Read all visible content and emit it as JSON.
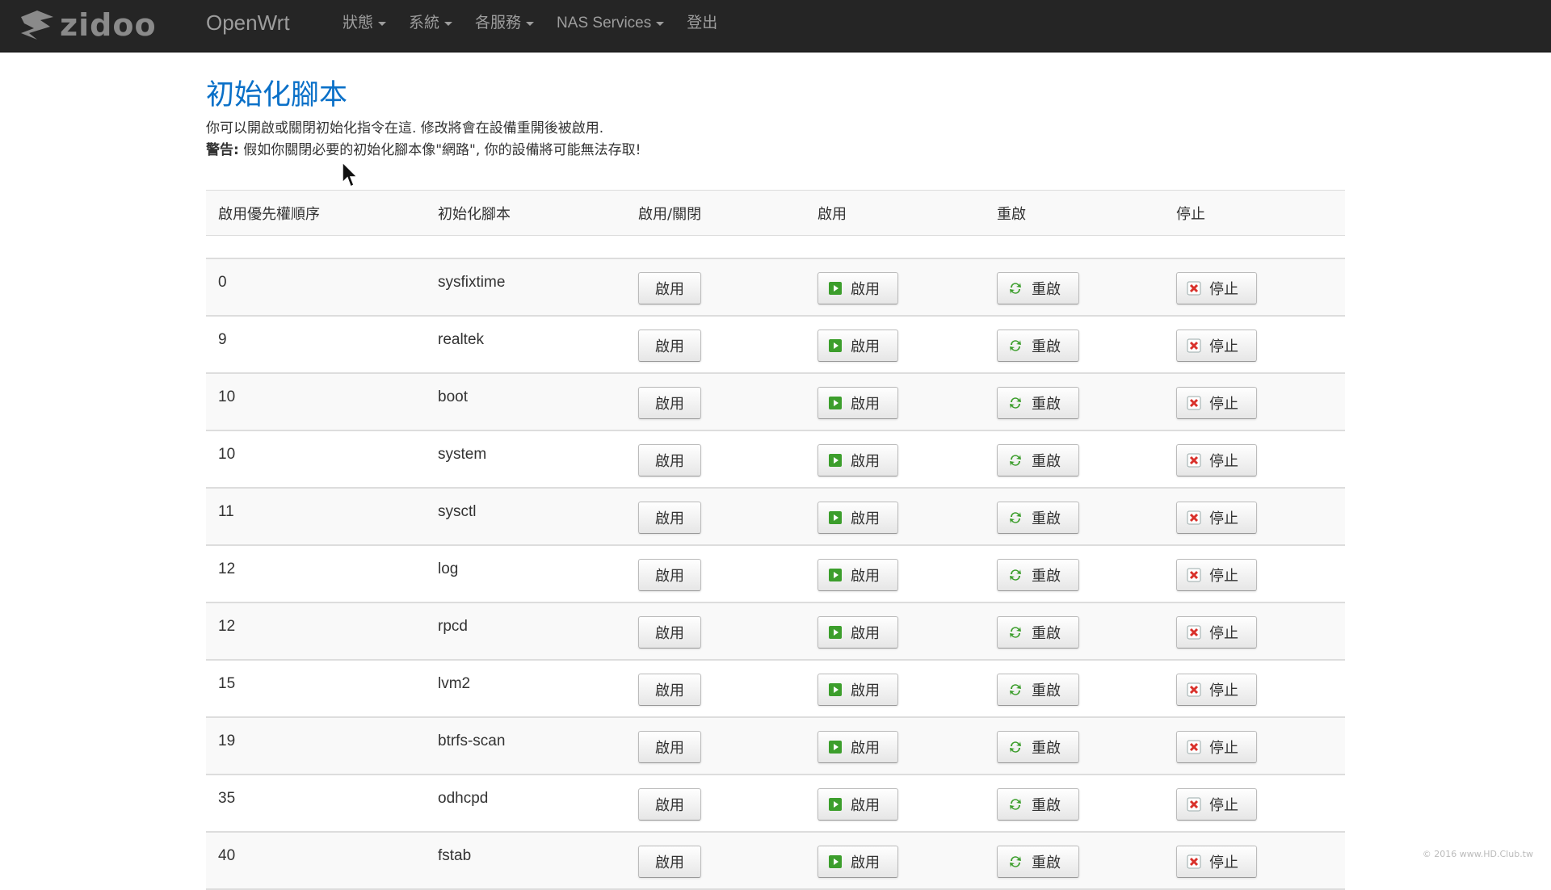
{
  "navbar": {
    "logo_text": "zidoo",
    "product": "OpenWrt",
    "menu": [
      {
        "label": "狀態",
        "dropdown": true
      },
      {
        "label": "系統",
        "dropdown": true
      },
      {
        "label": "各服務",
        "dropdown": true
      },
      {
        "label": "NAS Services",
        "dropdown": true
      },
      {
        "label": "登出",
        "dropdown": false
      }
    ]
  },
  "page": {
    "title": "初始化腳本",
    "description": "你可以開啟或關閉初始化指令在這. 修改將會在設備重開後被啟用.",
    "warning_label": "警告:",
    "warning_text": " 假如你關閉必要的初始化腳本像\"網路\", 你的設備將可能無法存取!"
  },
  "table": {
    "headers": {
      "priority": "啟用優先權順序",
      "script": "初始化腳本",
      "toggle": "啟用/關閉",
      "start": "啟用",
      "restart": "重啟",
      "stop": "停止"
    },
    "button_labels": {
      "toggle": "啟用",
      "start": "啟用",
      "restart": "重啟",
      "stop": "停止"
    },
    "rows": [
      {
        "priority": "0",
        "script": "sysfixtime"
      },
      {
        "priority": "9",
        "script": "realtek"
      },
      {
        "priority": "10",
        "script": "boot"
      },
      {
        "priority": "10",
        "script": "system"
      },
      {
        "priority": "11",
        "script": "sysctl"
      },
      {
        "priority": "12",
        "script": "log"
      },
      {
        "priority": "12",
        "script": "rpcd"
      },
      {
        "priority": "15",
        "script": "lvm2"
      },
      {
        "priority": "19",
        "script": "btrfs-scan"
      },
      {
        "priority": "35",
        "script": "odhcpd"
      },
      {
        "priority": "40",
        "script": "fstab"
      }
    ]
  },
  "watermark": "© 2016 www.HD.Club.tw",
  "colors": {
    "navbar_bg": "#252525",
    "title": "#0a70c8",
    "start_icon": "#3c9e2c",
    "stop_icon": "#d9312b"
  }
}
